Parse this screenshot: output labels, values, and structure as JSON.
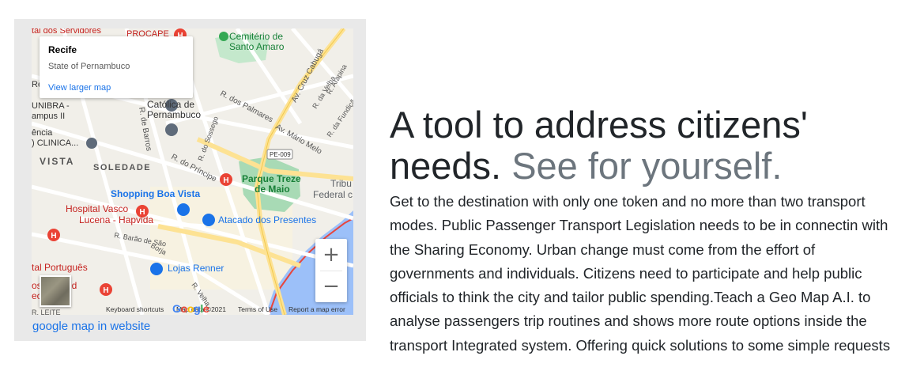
{
  "map": {
    "info_window": {
      "title": "Recife",
      "subtitle": "State of Pernambuco",
      "link": "View larger map"
    },
    "labels": {
      "servidores": "tal dos Servidores",
      "procape": "PROCAPE",
      "cemiterio_1": "Cemitério de",
      "cemiterio_2": "Santo Amaro",
      "cruz_cabuga": "Av. Cruz Cabugá",
      "arapina": "R. Arapina",
      "velha": "R. da Velha",
      "fundicao": "R. da Fundição",
      "catolica_1": "Católica de",
      "catolica_2": "Pernambuco",
      "palmares": "R. dos Palmares",
      "mario_melo": "Av. Mário Melo",
      "barros": "R. de Barros",
      "recreio": "Recreio",
      "unibra": "UNIBRA -",
      "campus": "ampus II",
      "encia": "ência",
      "clinica": ") CLINICA...",
      "vista": "VISTA",
      "soledade": "SOLEDADE",
      "sossego": "R. do Sossego",
      "pe009": "PE-009",
      "principe": "R. do Príncipe",
      "parque_1": "Parque Treze",
      "parque_2": "de Maio",
      "tribu": "Tribu",
      "federal": "Federal c",
      "shopping": "Shopping Boa Vista",
      "hospital_1": "Hospital Vasco",
      "hospital_2": "Lucena - Hapvida",
      "atacado": "Atacado dos Presentes",
      "barao": "R. Barão de São",
      "borja": "Borja",
      "portugues": "tal Português",
      "lojas": "Lojas Renner",
      "imed_1": "os Unimed",
      "imed_2": "ecife III",
      "velha2": "R. Velha",
      "leite": "R. LEITE"
    },
    "zoom_in": "+",
    "zoom_out": "−",
    "attribution": {
      "shortcuts": "Keyboard shortcuts",
      "map_data": "Map data ©2021",
      "terms": "Terms of Use",
      "report": "Report a map error"
    },
    "google_logo": [
      "G",
      "o",
      "o",
      "g",
      "l",
      "e"
    ],
    "logo_colors": [
      "#4285f4",
      "#ea4335",
      "#fbbc05",
      "#4285f4",
      "#34a853",
      "#ea4335"
    ],
    "caption": "google map in website"
  },
  "headline": {
    "main": "A tool to address citizens' needs.",
    "muted": "See for yourself."
  },
  "body": "Get to the destination with only one token and no more than two transport modes. Public Passenger Transport Legislation needs to be in connectin with the Sharing Economy. Urban change must come from the effort of governments and individuals. Citizens need to participate and help public officials to think the city and tailor public spending.Teach a Geo Map A.I. to analyse passengers trip routines and shows more route options inside the transport Integrated system. Offering quick solutions to some simple requests",
  "colors": {
    "link": "#1a73e8",
    "muted": "#6c757d",
    "text": "#212529",
    "park": "#a8dab5",
    "water": "#9cc0f9",
    "highway": "#fde293",
    "hospital": "#ea4335",
    "shop": "#1a73e8"
  }
}
